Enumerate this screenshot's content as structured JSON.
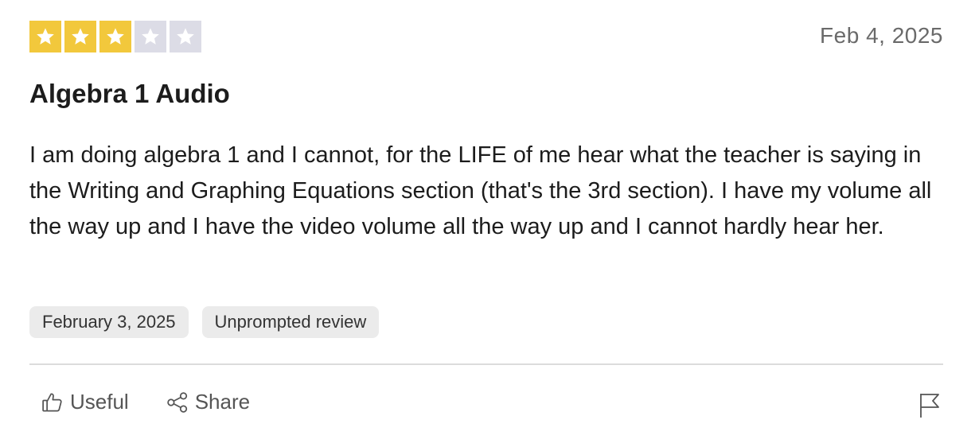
{
  "review": {
    "rating": 3,
    "max_rating": 5,
    "star_filled_color": "#F2C83C",
    "star_empty_color": "#DCDCE6",
    "date_published": "Feb 4, 2025",
    "title": "Algebra 1 Audio",
    "body": "I am doing algebra 1 and I cannot, for the LIFE of me hear what the teacher is saying in the Writing and Graphing Equations section (that's the 3rd section). I have my volume all the way up and I have the video volume all the way up and I cannot hardly hear her.",
    "tags": {
      "experience_date": "February 3, 2025",
      "review_type": "Unprompted review"
    }
  },
  "actions": {
    "useful_label": "Useful",
    "useful_icon": "thumbs-up-icon",
    "share_label": "Share",
    "share_icon": "share-icon",
    "report_icon": "flag-icon"
  }
}
